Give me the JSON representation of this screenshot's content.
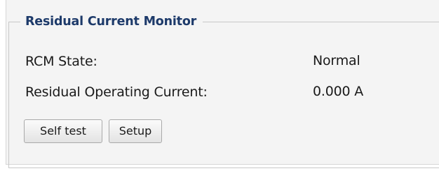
{
  "monitor": {
    "title": "Residual Current Monitor",
    "rows": [
      {
        "label": "RCM State:",
        "value": "Normal"
      },
      {
        "label": "Residual Operating Current:",
        "value": "0.000 A"
      }
    ],
    "buttons": {
      "self_test": "Self test",
      "setup": "Setup"
    }
  }
}
